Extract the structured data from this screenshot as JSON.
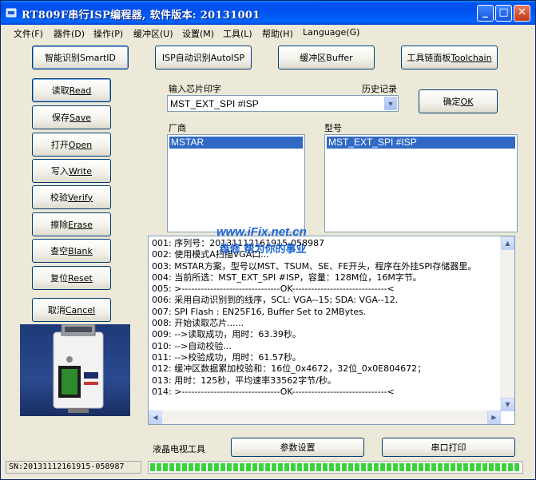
{
  "window": {
    "title": "RT809F串行ISP编程器, 软件版本: 20131001",
    "controls": [
      "_",
      "□",
      "✕"
    ]
  },
  "menu": [
    {
      "label": "文件",
      "key": "(F)"
    },
    {
      "label": "器件",
      "key": "(D)"
    },
    {
      "label": "操作",
      "key": "(P)"
    },
    {
      "label": "缓冲区",
      "key": "(U)"
    },
    {
      "label": "设置",
      "key": "(M)"
    },
    {
      "label": "工具",
      "key": "(L)"
    },
    {
      "label": "帮助",
      "key": "(H)"
    },
    {
      "label": "Language",
      "key": "(G)"
    }
  ],
  "top_buttons": {
    "smart_id": {
      "cn": "智能识别 ",
      "en": "SmartID"
    },
    "isp_auto": {
      "cn": "ISP自动识别 ",
      "en": "AutoISP"
    },
    "buffer": {
      "cn": "缓冲区 ",
      "en": "Buffer"
    },
    "toolchain": {
      "cn": "工具链面板 ",
      "en": "Toolchain"
    }
  },
  "side_buttons": [
    {
      "cn": "读取 ",
      "en": "Read"
    },
    {
      "cn": "保存 ",
      "en": "Save"
    },
    {
      "cn": "打开 ",
      "en": "Open"
    },
    {
      "cn": "写入 ",
      "en": "Write"
    },
    {
      "cn": "校验 ",
      "en": "Verify"
    },
    {
      "cn": "擦除 ",
      "en": "Erase"
    },
    {
      "cn": "查空 ",
      "en": "Blank"
    },
    {
      "cn": "复位 ",
      "en": "Reset"
    },
    {
      "cn": "取消 ",
      "en": "Cancel"
    }
  ],
  "chip_input": {
    "label": "输入芯片印字",
    "history_label": "历史记录",
    "value": "MST_EXT_SPI #ISP",
    "ok_button": {
      "cn": "确定 ",
      "en": "OK"
    }
  },
  "manufacturer": {
    "label": "厂商",
    "selected": "MSTAR"
  },
  "model": {
    "label": "型号",
    "selected": "MST_EXT_SPI #ISP"
  },
  "watermark": {
    "line1": "www.iFix.net.cn",
    "line2": "维修 帮为你的事业"
  },
  "log": [
    "001: 序列号：20131112161915-058987",
    "002: 使用模式A扫描VGA口...",
    "003: MSTAR方案，型号以MST、TSUM、SE、FE开头，程序在外挂SPI存储器里。",
    "004: 当前所选：MST_EXT_SPI #ISP，容量：128M位，16M字节。",
    "005: >-------------------------------OK------------------------------<",
    "006: 采用自动识别到的线序，SCL: VGA--15; SDA: VGA--12.",
    "007: SPI Flash : EN25F16, Buffer Set to 2MBytes.",
    "008: 开始读取芯片......",
    "009: -->读取成功，用时：63.39秒。",
    "010: -->自动校验...",
    "011: -->校验成功，用时：61.57秒。",
    "012: 缓冲区数据累加校验和：16位_0x4672，32位_0x0E804672；",
    "013: 用时：125秒，平均速率33562字节/秒。",
    "014: >-------------------------------OK------------------------------<"
  ],
  "bottom": {
    "tool_label": "液晶电视工具",
    "params_button": "参数设置",
    "serial_button": "串口打印"
  },
  "status": {
    "sn": "SN:20131112161915-058987",
    "progress": 1.0
  },
  "colors": {
    "titlebar": "#0053ee",
    "selection": "#316ac5",
    "progress": "#3bd23b",
    "watermark": "#1b64d4"
  }
}
